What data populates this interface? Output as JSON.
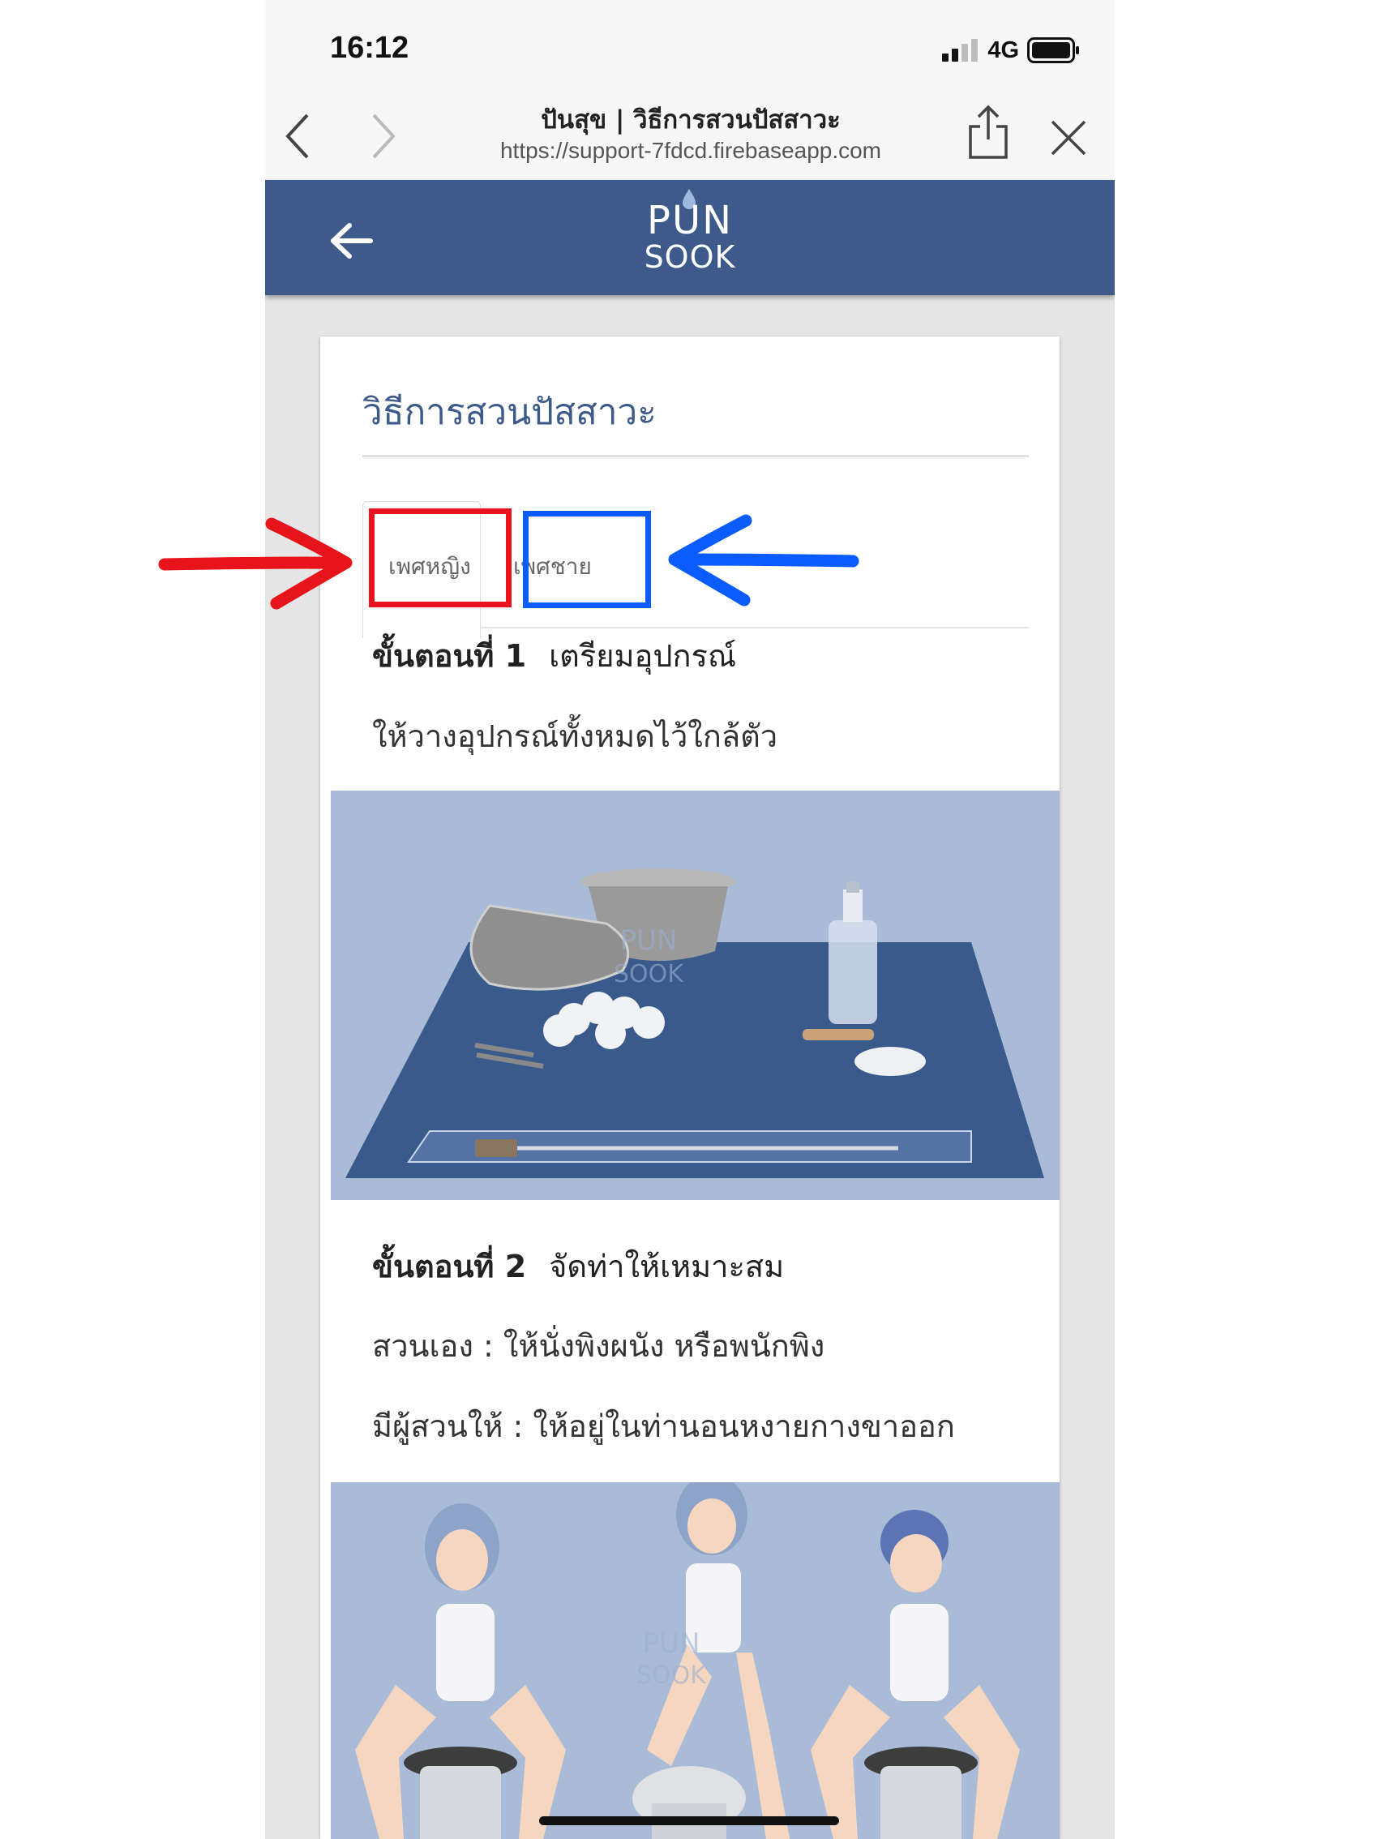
{
  "status_bar": {
    "time": "16:12",
    "network": "4G"
  },
  "browser": {
    "page_title": "ปันสุข | วิธีการสวนปัสสาวะ",
    "url": "https://support-7fdcd.firebaseapp.com"
  },
  "app_header": {
    "logo_top": "PUN",
    "logo_bottom": "SOOK"
  },
  "card": {
    "title": "วิธีการสวนปัสสาวะ",
    "tabs": [
      {
        "label": "เพศหญิง",
        "active": true
      },
      {
        "label": "เพศชาย",
        "active": false
      }
    ],
    "steps": [
      {
        "label": "ขั้นตอนที่ 1",
        "heading": "เตรียมอุปกรณ์",
        "lines": [
          "ให้วางอุปกรณ์ทั้งหมดไว้ใกล้ตัว"
        ]
      },
      {
        "label": "ขั้นตอนที่ 2",
        "heading": "จัดท่าให้เหมาะสม",
        "lines": [
          "สวนเอง : ให้นั่งพิงผนัง หรือพนักพิง",
          "มีผู้สวนให้ : ให้อยู่ในท่านอนหงายกางขาออก"
        ]
      }
    ],
    "watermark_top": "PUN",
    "watermark_bottom": "SOOK"
  },
  "annotations": {
    "female_highlight_color": "#e8141c",
    "male_highlight_color": "#0a5cff"
  },
  "theme": {
    "header_color": "#3d5a8a",
    "illustration_bg": "#a9bbd6",
    "mat_color": "#3a5a8c"
  }
}
